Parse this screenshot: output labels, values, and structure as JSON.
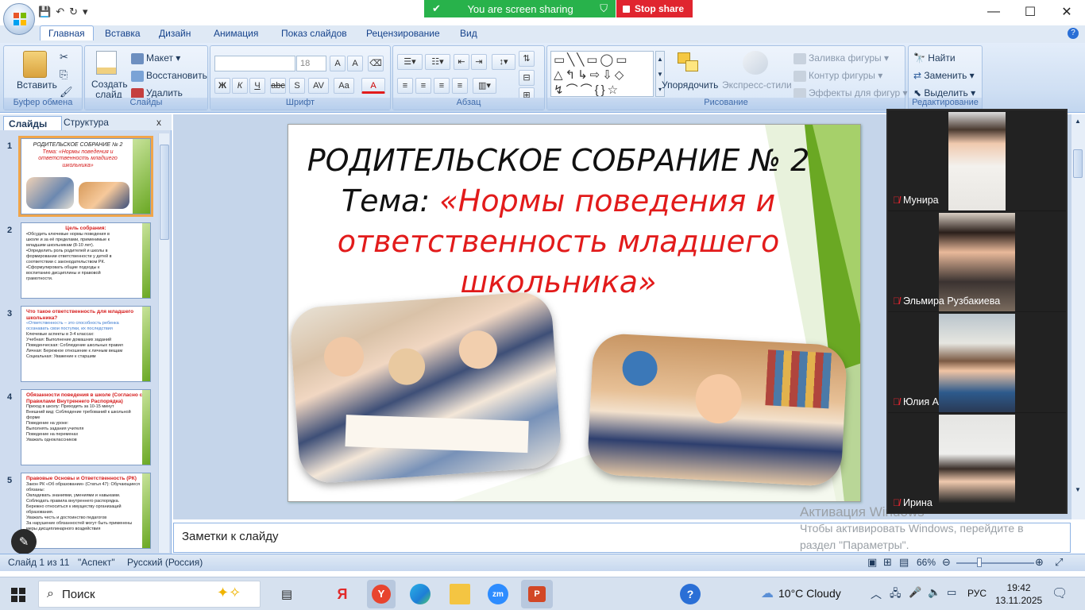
{
  "qat": {
    "save_glyph": "💾",
    "undo_glyph": "↶",
    "redo_glyph": "↻",
    "more_glyph": "▾"
  },
  "share": {
    "status": "You are screen sharing",
    "stop_label": "Stop share"
  },
  "tabs": [
    "Главная",
    "Вставка",
    "Дизайн",
    "Анимация",
    "Показ слайдов",
    "Рецензирование",
    "Вид"
  ],
  "ribbon": {
    "clipboard": {
      "paste": "Вставить",
      "title": "Буфер обмена"
    },
    "slides": {
      "new_slide": "Создать слайд",
      "layout": "Макет",
      "reset": "Восстановить",
      "delete": "Удалить",
      "title": "Слайды"
    },
    "font": {
      "size": "18",
      "title": "Шрифт",
      "bold": "Ж",
      "italic": "К",
      "underline": "Ч",
      "strike": "abc",
      "shadow": "S",
      "spacing": "AV",
      "case": "Aa",
      "color": "A"
    },
    "paragraph": {
      "title": "Абзац"
    },
    "drawing": {
      "arrange": "Упорядочить",
      "styles": "Экспресс-стили",
      "fill": "Заливка фигуры",
      "outline": "Контур фигуры",
      "effects": "Эффекты для фигур",
      "title": "Рисование"
    },
    "editing": {
      "find": "Найти",
      "replace": "Заменить",
      "select": "Выделить",
      "title": "Редактирование"
    }
  },
  "left_panel": {
    "tab_slides": "Слайды",
    "tab_outline": "Структура",
    "close": "x"
  },
  "thumbnails": [
    {
      "num": "1",
      "lines": [
        "РОДИТЕЛЬСКОЕ СОБРАНИЕ № 2",
        "Тема: «Нормы поведения и",
        "ответственность младшего",
        "школьника»"
      ]
    },
    {
      "num": "2",
      "title": "Цель собрания:",
      "lines": [
        "•Обсудить ключевые нормы поведения в",
        "школе и за её пределами, применимые к",
        "младшим школьникам (8-10 лет).",
        "•Определить роль родителей и школы в",
        "формировании ответственности у детей в",
        "соответствии с законодательством РК.",
        "•Сформулировать общие подходы к",
        "воспитанию дисциплины и правовой",
        "грамотности."
      ]
    },
    {
      "num": "3",
      "title": "Что такое ответственность для младшего школьника?",
      "lines": [
        "«Ответственность – это способность ребенка",
        "осознавать свои поступки, их последствия",
        "Ключевые аспекты в 3-4 классах:",
        "Учебная: Выполнение домашних заданий",
        "Поведенческая: Соблюдение школьных правил",
        "Личная: Бережное отношение к личным вещам",
        "Социальная: Уважение к старшим"
      ]
    },
    {
      "num": "4",
      "title": "Обязанности поведения в школе (Согласно с Правилами Внутреннего Распорядка)",
      "lines": [
        "Приход в школу: Приходить за 10-15 минут",
        "Внешний вид: Соблюдение требований к школьной форме",
        "Поведение на уроке:",
        "Выполнять задания учителя",
        "Поведение на переменах",
        "Уважать одноклассников"
      ]
    },
    {
      "num": "5",
      "title": "Правовые Основы и Ответственность (РК)",
      "lines": [
        "Закон РК «Об образовании» (Статья 47): Обучающиеся",
        "обязаны:",
        "Овладевать знаниями, умениями и навыками.",
        "Соблюдать правила внутреннего распорядка.",
        "Бережно относиться к имуществу организаций",
        "образования.",
        "Уважать честь и достоинство педагогов",
        "За нарушение обязанностей могут быть применены",
        "меры дисциплинарного воздействия"
      ]
    }
  ],
  "slide": {
    "line1": "РОДИТЕЛЬСКОЕ СОБРАНИЕ № 2",
    "line2_black": "Тема: ",
    "line2_red": "«Нормы поведения и",
    "line3": "ответственность младшего",
    "line4": "школьника»"
  },
  "notes_placeholder": "Заметки к слайду",
  "activation": {
    "title": "Активация Windows",
    "line1": "Чтобы активировать Windows, перейдите в",
    "line2": "раздел \"Параметры\"."
  },
  "participants": [
    {
      "name": "Мунира"
    },
    {
      "name": "Эльмира Рузбакиева"
    },
    {
      "name": "Юлия А"
    },
    {
      "name": "Ирина"
    }
  ],
  "status": {
    "slide_of": "Слайд 1 из 11",
    "theme": "\"Аспект\"",
    "lang": "Русский (Россия)",
    "zoom": "66%"
  },
  "taskbar": {
    "search": "Поиск",
    "weather": "10°C  Cloudy",
    "lang": "РУС",
    "time": "19:42",
    "date": "13.11.2025"
  },
  "colors": {
    "accent_red": "#e21b1b",
    "share_green": "#28b24b",
    "stop_red": "#e0252f",
    "slide_green": "#6aa823"
  }
}
